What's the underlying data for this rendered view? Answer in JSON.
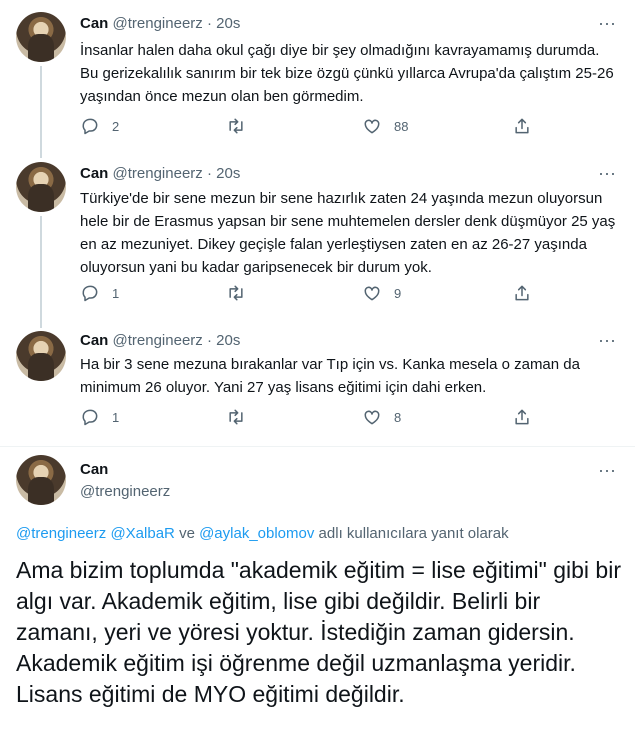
{
  "tweets": [
    {
      "name": "Can",
      "handle": "@trengineerz",
      "sep": "·",
      "time": "20s",
      "text": "İnsanlar halen daha okul çağı diye bir şey olmadığını kavrayamamış durumda. Bu gerizekalılık sanırım bir tek bize özgü çünkü yıllarca Avrupa'da çalıştım 25-26 yaşından önce mezun olan ben görmedim.",
      "replies": "2",
      "likes": "88"
    },
    {
      "name": "Can",
      "handle": "@trengineerz",
      "sep": "·",
      "time": "20s",
      "text": "Türkiye'de bir sene mezun bir sene hazırlık zaten 24 yaşında mezun oluyorsun hele bir de Erasmus yapsan bir sene muhtemelen dersler denk düşmüyor 25 yaş en az mezuniyet. Dikey geçişle falan yerleştiysen zaten en az 26-27 yaşında oluyorsun yani bu kadar garipsenecek bir durum yok.",
      "replies": "1",
      "likes": "9"
    },
    {
      "name": "Can",
      "handle": "@trengineerz",
      "sep": "·",
      "time": "20s",
      "text": "Ha bir 3 sene mezuna bırakanlar var Tıp için vs. Kanka mesela o zaman da minimum 26 oluyor. Yani 27 yaş lisans eğitimi için dahi erken.",
      "replies": "1",
      "likes": "8"
    }
  ],
  "main": {
    "name": "Can",
    "handle": "@trengineerz",
    "reply_mention_1": "@trengineerz",
    "reply_mention_2": "@XalbaR",
    "reply_and": "ve",
    "reply_mention_3": "@aylak_oblomov",
    "reply_suffix": "adlı kullanıcılara yanıt olarak",
    "text": "Ama bizim toplumda \"akademik eğitim = lise eğitimi\" gibi bir algı var. Akademik eğitim, lise gibi değildir. Belirli bir zamanı, yeri ve yöresi yoktur. İstediğin zaman gidersin. Akademik eğitim işi öğrenme değil uzmanlaşma yeridir. Lisans eğitimi de MYO eğitimi değildir."
  },
  "icons": {
    "more": "more-icon",
    "reply": "reply-icon",
    "retweet": "retweet-icon",
    "like": "like-icon",
    "share": "share-icon"
  },
  "colors": {
    "text": "#0f1419",
    "muted": "#536471",
    "link": "#1d9bf0"
  }
}
